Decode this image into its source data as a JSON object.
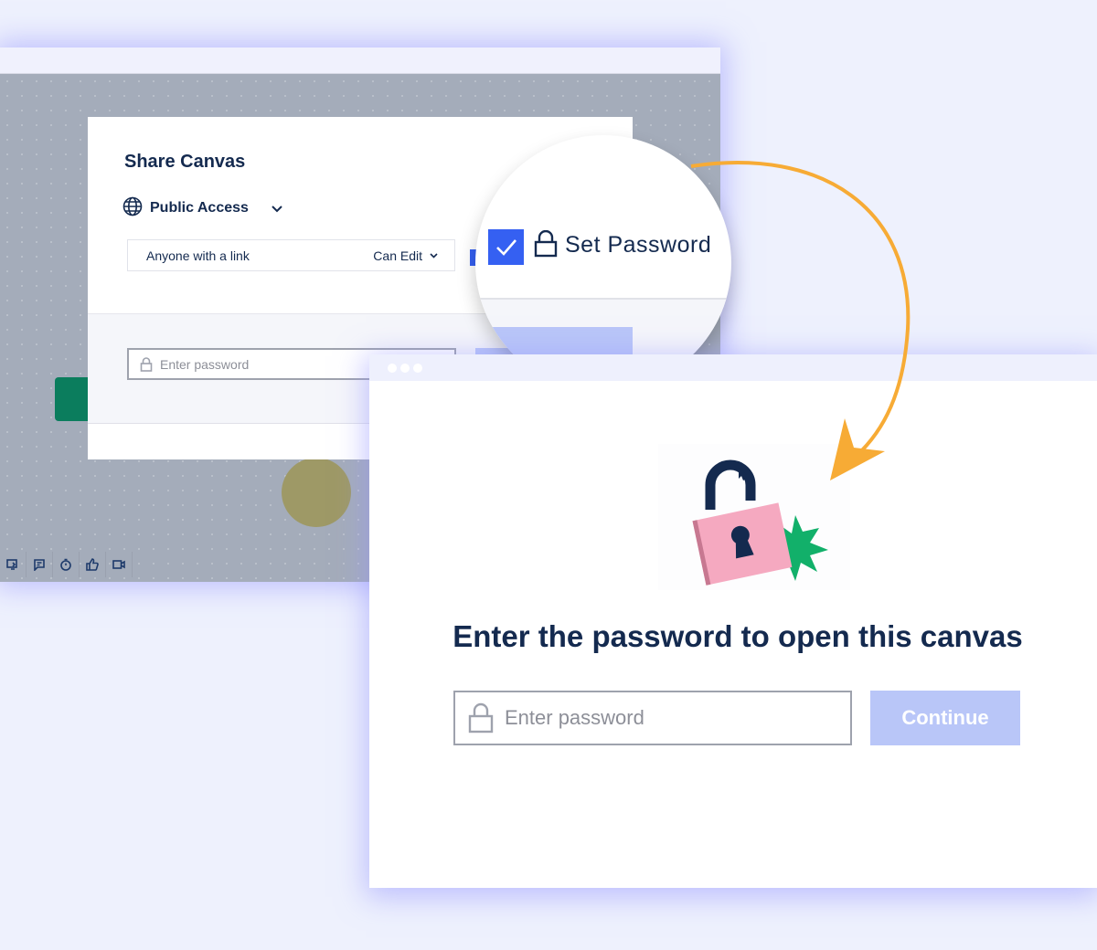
{
  "share_dialog": {
    "title": "Share Canvas",
    "access_label": "Public Access",
    "link_scope": "Anyone with a link",
    "permission": "Can Edit",
    "password_placeholder": "Enter password"
  },
  "magnifier": {
    "checkbox_checked": true,
    "label": "Set Password"
  },
  "toolbar": {
    "icons": [
      "share-icon",
      "comment-icon",
      "timer-icon",
      "thumbs-up-icon",
      "video-icon"
    ]
  },
  "password_gate": {
    "heading": "Enter the password to open this canvas",
    "placeholder": "Enter password",
    "continue_label": "Continue"
  },
  "colors": {
    "navy": "#142a4f",
    "accent_blue": "#3560f2",
    "disabled_button": "#b9c6f8",
    "arrow_orange": "#f7ab35",
    "lock_pink": "#f5a9c0",
    "burst_green": "#12b06a",
    "background": "#eef1fd"
  }
}
